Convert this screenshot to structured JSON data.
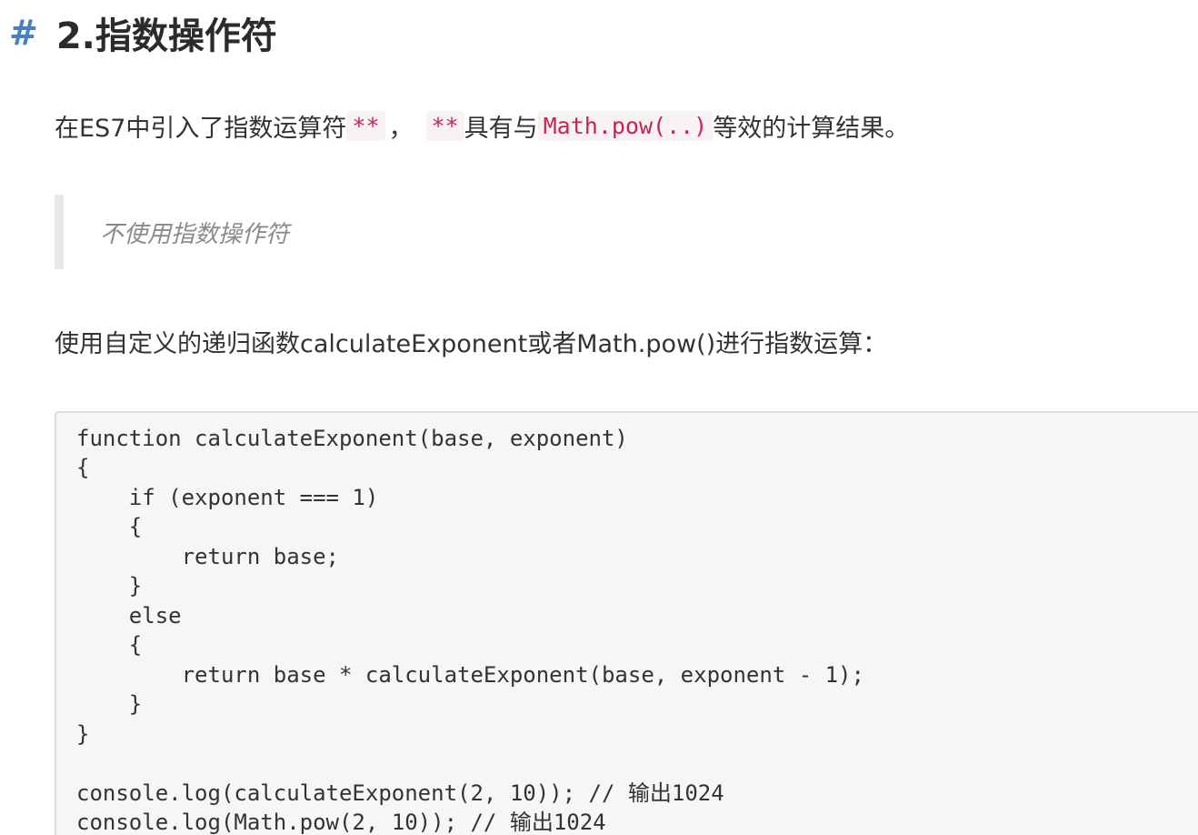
{
  "heading": {
    "hash": "#",
    "title": "2.指数操作符"
  },
  "intro": {
    "text_before": "在ES7中引入了指数运算符",
    "operator": "**",
    "separator": "，",
    "operator2": "**",
    "text_middle": "具有与",
    "math_pow": "Math.pow(..)",
    "text_after": "等效的计算结果。"
  },
  "blockquote": {
    "text": "不使用指数操作符"
  },
  "paragraph": {
    "text": "使用自定义的递归函数calculateExponent或者Math.pow()进行指数运算："
  },
  "code": {
    "lines": [
      "function calculateExponent(base, exponent)",
      "{",
      "    if (exponent === 1)",
      "    {",
      "        return base;",
      "    }",
      "    else",
      "    {",
      "        return base * calculateExponent(base, exponent - 1);",
      "    }",
      "}",
      "",
      "console.log(calculateExponent(2, 10)); // 输出1024",
      "console.log(Math.pow(2, 10)); // 输出1024"
    ]
  },
  "colors": {
    "hash": "#4a7fc1",
    "inline_code_text": "#c7254e",
    "inline_code_bg": "#f9f2f4",
    "code_bg": "#f6f6f6",
    "blockquote_bar": "#e8e8e8"
  }
}
